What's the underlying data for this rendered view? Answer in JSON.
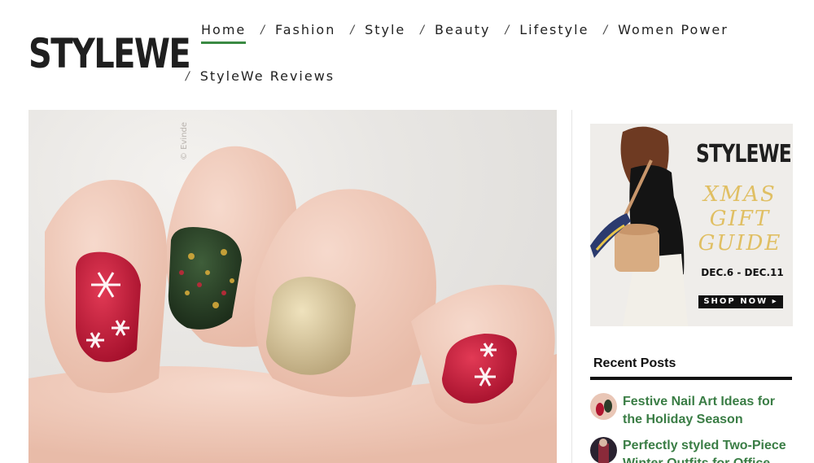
{
  "logo": {
    "text": "STYLEWE"
  },
  "nav": {
    "row1": [
      {
        "label": "Home",
        "active": true
      },
      {
        "label": "Fashion"
      },
      {
        "label": "Style"
      },
      {
        "label": "Beauty"
      },
      {
        "label": "Lifestyle"
      },
      {
        "label": "Women Power"
      }
    ],
    "row2": [
      {
        "label": "StyleWe Reviews"
      }
    ],
    "separator": "/",
    "accent_color": "#3a8a43"
  },
  "hero": {
    "watermark": "© Evinde"
  },
  "sidebar": {
    "ad": {
      "brand": "STYLEWE",
      "title_line1": "XMAS",
      "title_line2": "GIFT",
      "title_line3": "GUIDE",
      "dates": "DEC.6 - DEC.11",
      "button": "SHOP NOW ▸"
    },
    "recent_posts": {
      "heading": "Recent Posts",
      "items": [
        {
          "title": "Festive Nail Art Ideas for the Holiday Season",
          "thumb": "nail-thumbnail"
        },
        {
          "title": "Perfectly styled Two-Piece Winter Outfits for Office",
          "thumb": "outfit-thumbnail"
        }
      ]
    },
    "link_color": "#3a7d45"
  }
}
